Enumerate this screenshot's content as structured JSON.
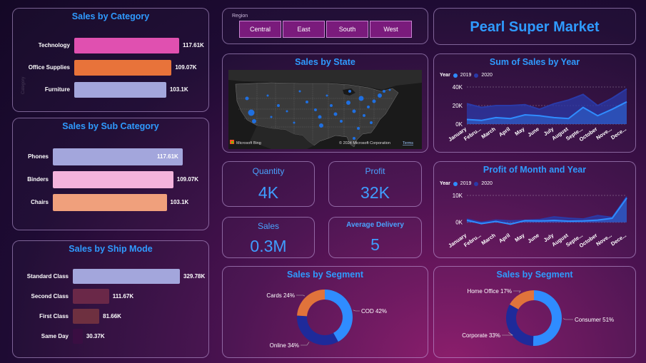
{
  "colors": {
    "blue": "#2f9bff",
    "navy": "#1e2a9a",
    "orange": "#e0733b"
  },
  "category": {
    "title": "Sales by Category",
    "items": [
      {
        "label": "Technology",
        "value": "117.61K",
        "num": 117.61,
        "color": "#e050b0"
      },
      {
        "label": "Office Supplies",
        "value": "109.07K",
        "num": 109.07,
        "color": "#e8733a"
      },
      {
        "label": "Furniture",
        "value": "103.1K",
        "num": 103.1,
        "color": "#a3a6dc"
      }
    ]
  },
  "subcategory": {
    "title": "Sales by Sub Category",
    "items": [
      {
        "label": "Phones",
        "value": "117.61K",
        "num": 117.61,
        "color": "#a3a6dc"
      },
      {
        "label": "Binders",
        "value": "109.07K",
        "num": 109.07,
        "color": "#f4b3dc"
      },
      {
        "label": "Chairs",
        "value": "103.1K",
        "num": 103.1,
        "color": "#f0a07c"
      }
    ]
  },
  "shipmode": {
    "title": "Sales by Ship Mode",
    "items": [
      {
        "label": "Standard Class",
        "value": "329.78K",
        "num": 329.78,
        "color": "#a3a6dc"
      },
      {
        "label": "Second Class",
        "value": "111.67K",
        "num": 111.67,
        "color": "#6a2848"
      },
      {
        "label": "First Class",
        "value": "81.66K",
        "num": 81.66,
        "color": "#6e3040"
      },
      {
        "label": "Same Day",
        "value": "30.37K",
        "num": 30.37,
        "color": "#3a0e42"
      }
    ]
  },
  "region": {
    "label": "Region",
    "options": [
      "Central",
      "East",
      "South",
      "West"
    ]
  },
  "header": {
    "title": "Pearl Super Market"
  },
  "map": {
    "title": "Sales by State",
    "attribution_left": "Microsoft Bing",
    "attribution_right": "© 2024 Microsoft Corporation",
    "terms": "Terms"
  },
  "kpis": {
    "quantity": {
      "label": "Quantity",
      "value": "4K"
    },
    "profit": {
      "label": "Profit",
      "value": "32K"
    },
    "sales": {
      "label": "Sales",
      "value": "0.3M"
    },
    "delivery": {
      "label": "Average Delivery",
      "value": "5"
    }
  },
  "chart_data": [
    {
      "type": "area",
      "title": "Sum of Sales by Year",
      "legend_title": "Year",
      "x": [
        "January",
        "Febru...",
        "March",
        "April",
        "May",
        "June",
        "July",
        "August",
        "Septe...",
        "October",
        "Nove...",
        "Dece..."
      ],
      "yticks": [
        "0K",
        "20K",
        "40K"
      ],
      "ylim": [
        0,
        40000
      ],
      "series": [
        {
          "name": "2019",
          "color": "#2f8cff",
          "values": [
            5000,
            4000,
            7000,
            6000,
            10000,
            9000,
            7000,
            6000,
            18000,
            9000,
            16000,
            24000
          ]
        },
        {
          "name": "2020",
          "color": "#2a3aa8",
          "values": [
            22000,
            18000,
            20000,
            20000,
            21000,
            16000,
            22000,
            26000,
            32000,
            20000,
            28000,
            38000
          ]
        }
      ]
    },
    {
      "type": "area",
      "title": "Profit of Month and Year",
      "legend_title": "Year",
      "x": [
        "January",
        "Febru...",
        "March",
        "April",
        "May",
        "June",
        "July",
        "August",
        "Septe...",
        "October",
        "Nove...",
        "Dece..."
      ],
      "yticks": [
        "0K",
        "10K"
      ],
      "ylim": [
        -3000,
        10000
      ],
      "series": [
        {
          "name": "2019",
          "color": "#2f8cff",
          "values": [
            800,
            -500,
            300,
            -700,
            600,
            500,
            700,
            400,
            500,
            800,
            1500,
            9000
          ]
        },
        {
          "name": "2020",
          "color": "#2a3aa8",
          "values": [
            1200,
            0,
            800,
            500,
            700,
            1000,
            2000,
            1500,
            1200,
            2500,
            1800,
            9500
          ]
        }
      ]
    },
    {
      "type": "pie",
      "title": "Sales by Segment",
      "labels": [
        "COD 42%",
        "Online 34%",
        "Cards 24%"
      ],
      "values": [
        42,
        34,
        24
      ],
      "colors": [
        "#2f8cff",
        "#1e2a9a",
        "#e0733b"
      ]
    },
    {
      "type": "pie",
      "title": "Sales by Segment",
      "labels": [
        "Consumer 51%",
        "Corporate 33%",
        "Home Office 17%"
      ],
      "values": [
        51,
        33,
        17
      ],
      "colors": [
        "#2f8cff",
        "#1e2a9a",
        "#e0733b"
      ]
    }
  ]
}
